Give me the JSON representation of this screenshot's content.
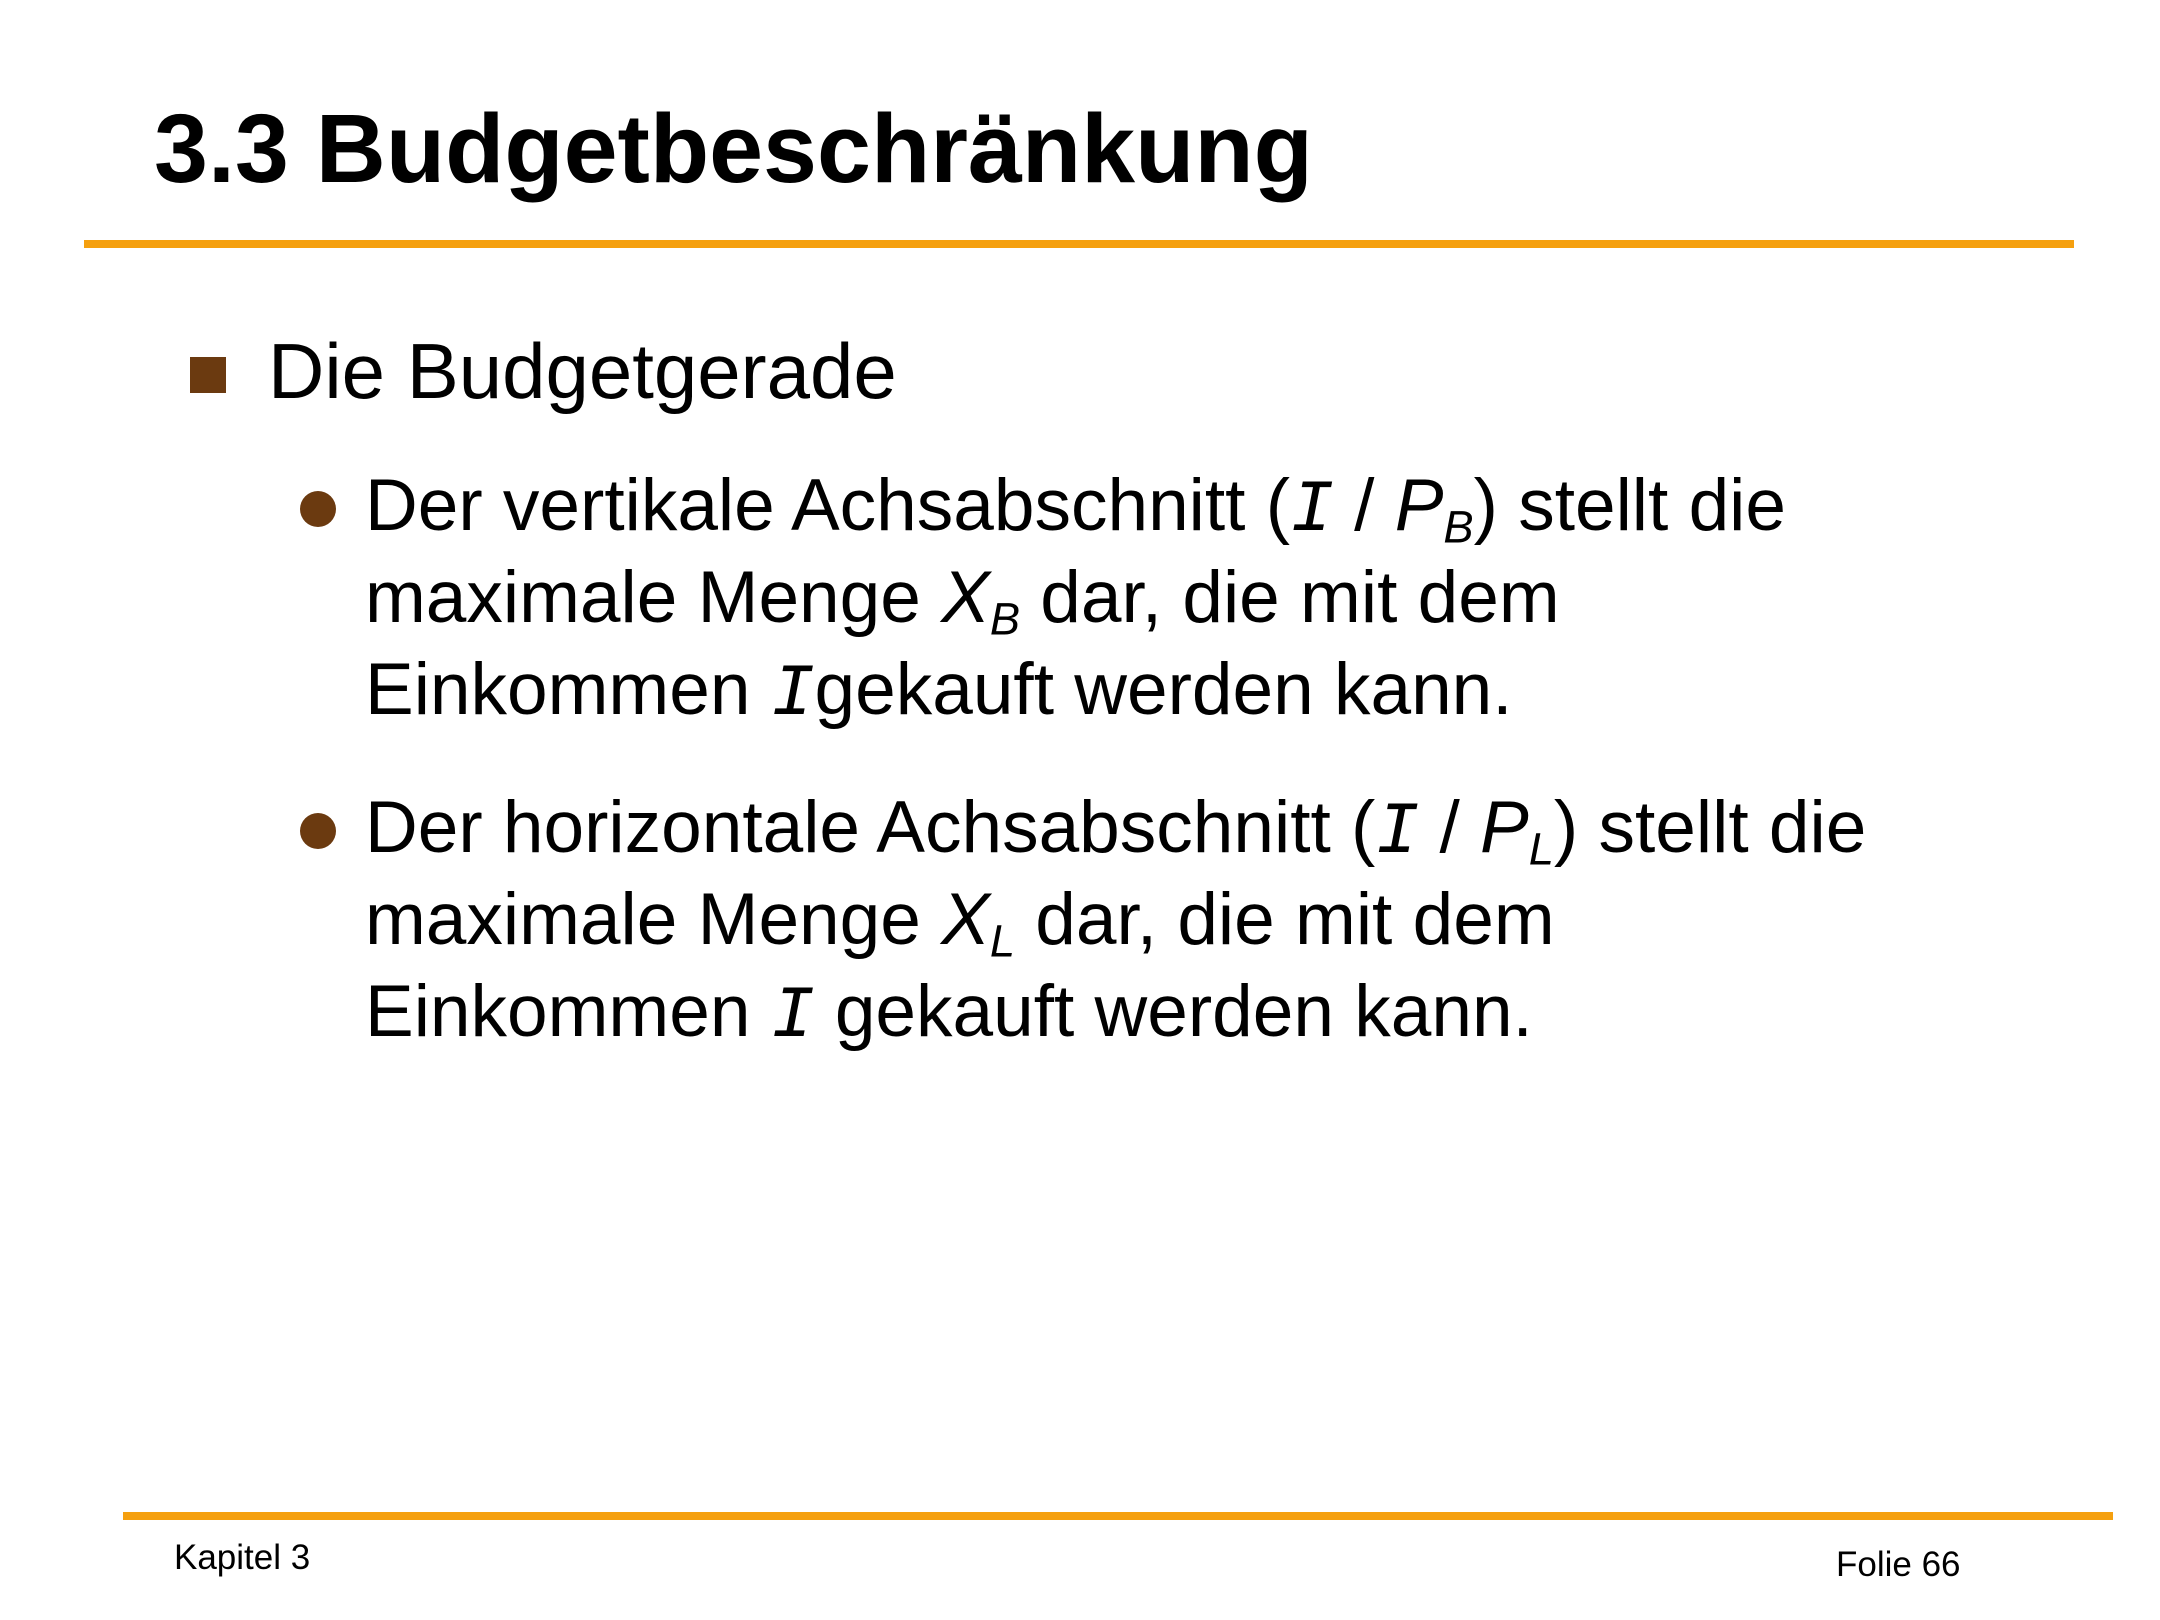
{
  "slide": {
    "title": "3.3 Budgetbeschränkung",
    "bullet": "Die Budgetgerade",
    "sub1": {
      "l1a": "Der vertikale Achsabschnitt (",
      "var_i": "I",
      "sep": " / ",
      "var_p": "P",
      "p_sub": "B",
      "l1b": ") stellt die",
      "l2a": "maximale Menge ",
      "var_x": "X",
      "x_sub": "B",
      "l2b": " dar, die mit dem",
      "l3a": "Einkommen ",
      "var_i2": "I",
      "l3b": "gekauft werden kann."
    },
    "sub2": {
      "l1a": "Der horizontale Achsabschnitt (",
      "var_i": "I",
      "sep": " / ",
      "var_p": "P",
      "p_sub": "L",
      "l1b": ") stellt die",
      "l2a": "maximale Menge ",
      "var_x": "X",
      "x_sub": "L",
      "l2b": " dar, die mit dem",
      "l3a": "Einkommen ",
      "var_i2": "I",
      "l3b": " gekauft werden kann."
    }
  },
  "footer": {
    "left": "Kapitel 3",
    "right": "Folie 66"
  },
  "colors": {
    "rule": "#f5a00f",
    "bullet": "#6b3a10"
  }
}
